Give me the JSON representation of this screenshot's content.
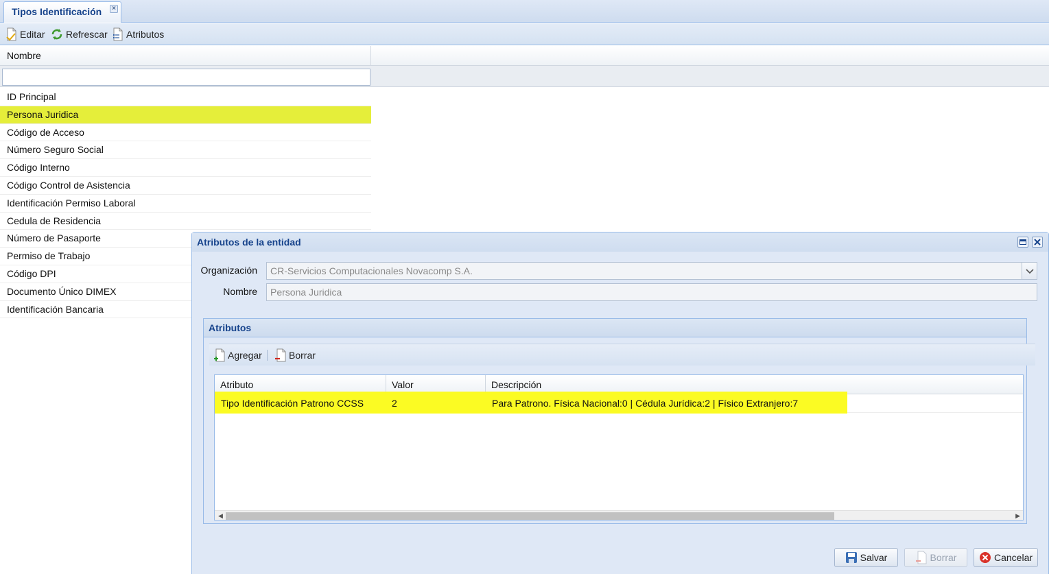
{
  "tab": {
    "title": "Tipos Identificación",
    "close_symbol": "×"
  },
  "toolbar": {
    "edit_label": "Editar",
    "refresh_label": "Refrescar",
    "attributes_label": "Atributos"
  },
  "grid": {
    "column_header": "Nombre",
    "filter_value": "",
    "selected_index": 1,
    "rows": [
      "ID Principal",
      "Persona Juridica",
      "Código de Acceso",
      "Número Seguro Social",
      "Código Interno",
      "Código Control de Asistencia",
      "Identificación Permiso Laboral",
      "Cedula de Residencia",
      "Número de Pasaporte",
      "Permiso de Trabajo",
      "Código DPI",
      "Documento Único DIMEX",
      "Identificación Bancaria"
    ]
  },
  "dialog": {
    "title": "Atributos de la entidad",
    "org_label": "Organización",
    "org_value": "CR-Servicios Computacionales Novacomp S.A.",
    "name_label": "Nombre",
    "name_value": "Persona Juridica",
    "attributes": {
      "title": "Atributos",
      "add_label": "Agregar",
      "delete_label": "Borrar",
      "columns": {
        "attribute": "Atributo",
        "value": "Valor",
        "description": "Descripción"
      },
      "rows": [
        {
          "attribute": "Tipo Identificación Patrono CCSS",
          "value": "2",
          "description": "Para Patrono. Física Nacional:0 | Cédula Jurídica:2 | Físico Extranjero:7"
        }
      ]
    },
    "footer": {
      "save_label": "Salvar",
      "delete_label": "Borrar",
      "cancel_label": "Cancelar"
    }
  },
  "colors": {
    "selection": "#e5ee3a",
    "highlight": "#fbfb23",
    "header_text": "#15428b"
  }
}
